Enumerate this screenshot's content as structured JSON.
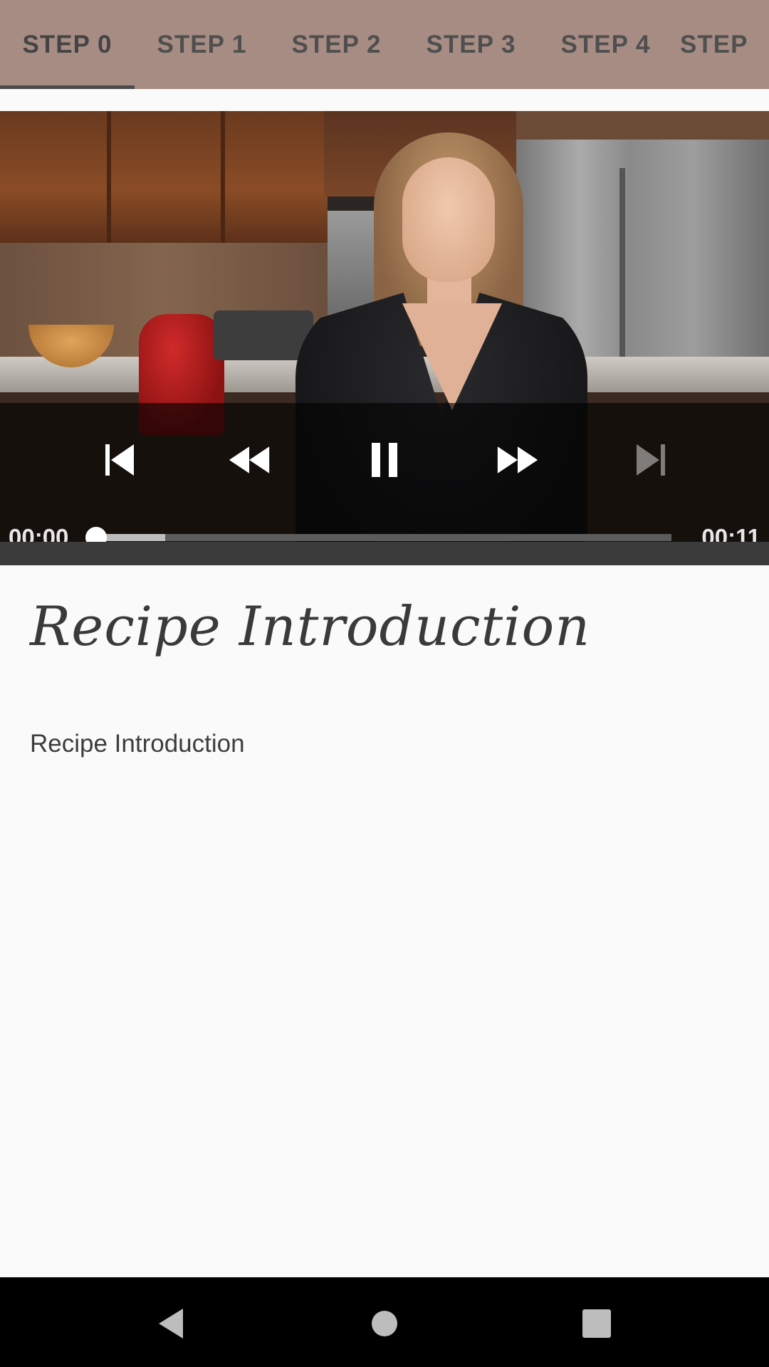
{
  "tabs": [
    {
      "label": "STEP 0",
      "active": true
    },
    {
      "label": "STEP 1",
      "active": false
    },
    {
      "label": "STEP 2",
      "active": false
    },
    {
      "label": "STEP 3",
      "active": false
    },
    {
      "label": "STEP 4",
      "active": false
    },
    {
      "label": "STEP",
      "active": false
    }
  ],
  "player": {
    "current_time": "00:00",
    "duration": "00:11",
    "progress_fraction": 0.0,
    "buffered_fraction": 0.12,
    "state": "playing",
    "controls": [
      "skip-previous-icon",
      "rewind-icon",
      "pause-icon",
      "fast-forward-icon",
      "skip-next-icon"
    ]
  },
  "step": {
    "title": "Recipe Introduction",
    "description": "Recipe Introduction"
  },
  "colors": {
    "tab_bar": "#a78c84",
    "background": "#fafafa",
    "indicator": "#4a4a4a"
  },
  "navbar": {
    "buttons": [
      "back-icon",
      "home-icon",
      "recents-icon"
    ]
  }
}
